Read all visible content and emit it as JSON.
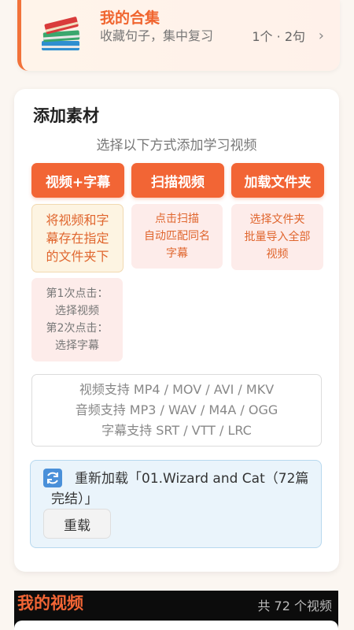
{
  "collection": {
    "title": "我的合集",
    "description": "收藏句子，集中复习",
    "count": "1个 · 2句",
    "chevron": "›"
  },
  "add_material": {
    "title": "添加素材",
    "subtitle": "选择以下方式添加学习视频",
    "buttons": [
      {
        "label": "视频+字幕",
        "description": "将视频和字\n幕存在指定\n的文件夹下"
      },
      {
        "label": "扫描视频",
        "description": "点击扫描\n自动匹配同名\n字幕"
      },
      {
        "label": "加载文件夹",
        "description": "选择文件夹\n批量导入全部\n视频"
      }
    ],
    "click_hint": "第1次点击：\n选择视频\n第2次点击：\n选择字幕",
    "formats": [
      "视频支持 MP4 / MOV / AVI / MKV",
      "音频支持 MP3 / WAV / M4A / OGG",
      "字幕支持 SRT / VTT / LRC"
    ],
    "reload": {
      "icon": "reload-icon",
      "text": "重新加载「01.Wizard and Cat（72篇完结）」",
      "button": "重载"
    }
  },
  "my_videos": {
    "title": "我的视频",
    "count": "共 72 个视频"
  },
  "colors": {
    "accent": "#f26535",
    "reload_bg": "#eaf4fb"
  }
}
